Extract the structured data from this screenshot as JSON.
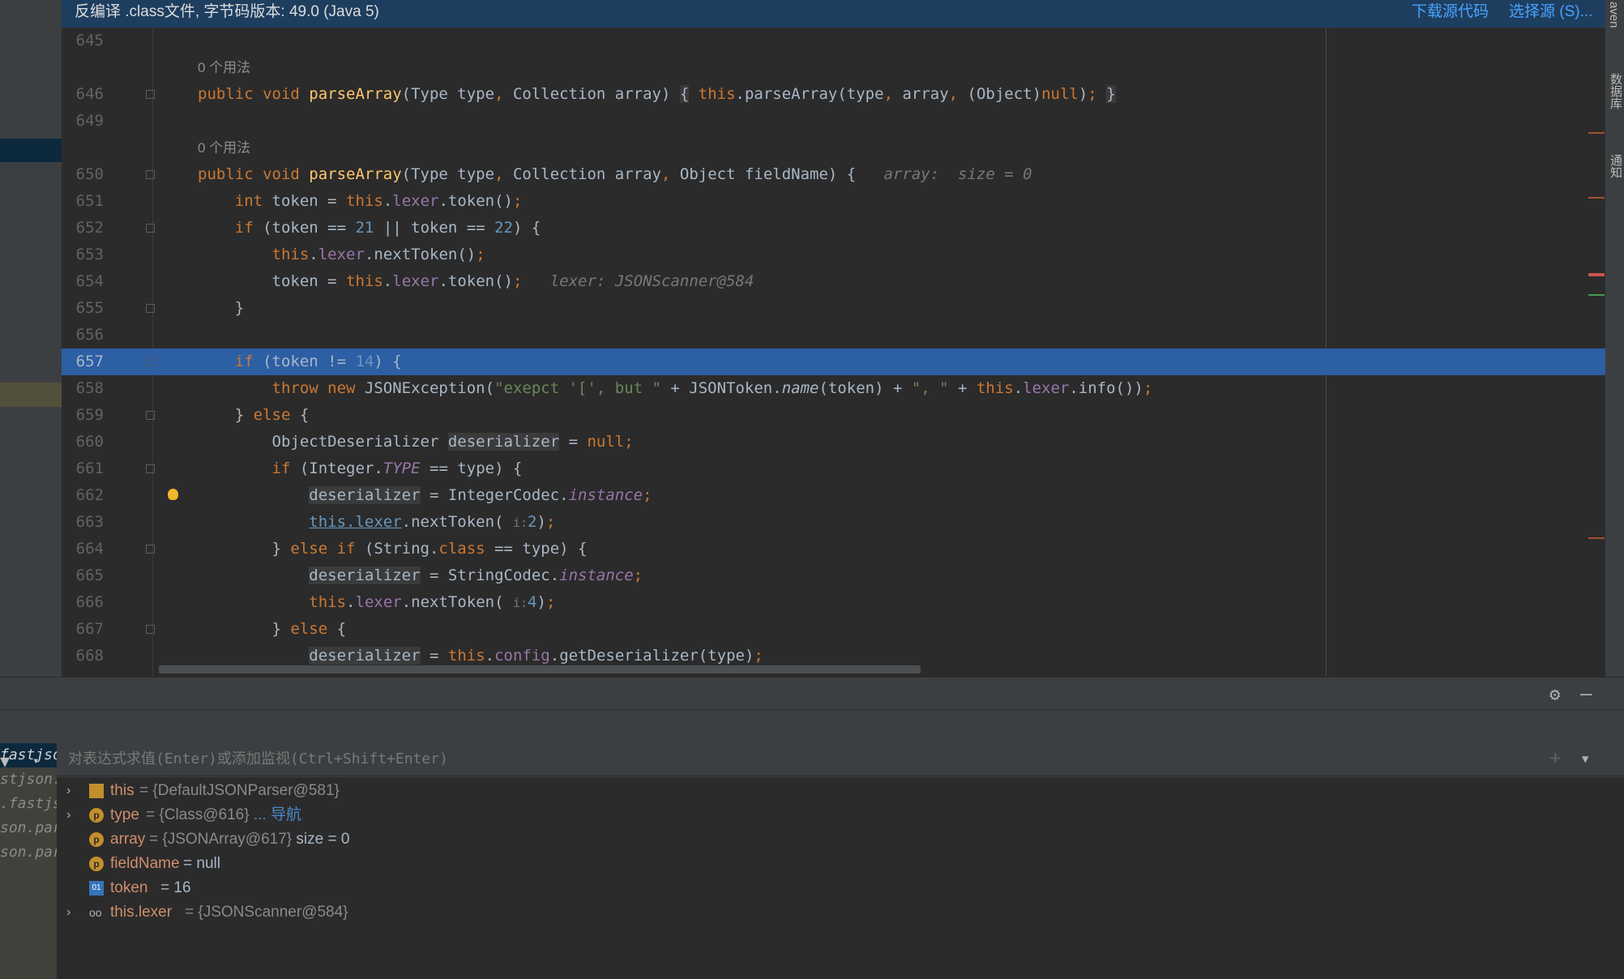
{
  "banner": {
    "title": "反编译 .class文件, 字节码版本: 49.0 (Java 5)",
    "download_source": "下载源代码",
    "choose_source": "选择源 (S)..."
  },
  "right_strip": {
    "maven": "aven",
    "database": "数据库",
    "notifications": "通知"
  },
  "editor": {
    "usage_hint": "0 个用法",
    "current_line": "657",
    "lines": [
      "645",
      "646",
      "649",
      "650",
      "651",
      "652",
      "653",
      "654",
      "655",
      "656",
      "657",
      "658",
      "659",
      "660",
      "661",
      "662",
      "663",
      "664",
      "665",
      "666",
      "667",
      "668"
    ],
    "inline_hints": {
      "array": "array:  size = 0",
      "lexer": "lexer: JSONScanner@584"
    },
    "param_hint_i": "i:"
  },
  "debug": {
    "eval_placeholder": "对表达式求值(Enter)或添加监视(Ctrl+Shift+Enter)",
    "frames": [
      "fastjson.p",
      "stjson.se",
      ".fastjson",
      "son.pars",
      "son.pars"
    ],
    "variables": [
      {
        "name": "this",
        "value": "= {DefaultJSONParser@581}",
        "extra": "",
        "icon": "stack-icon"
      },
      {
        "name": "type",
        "value": "= {Class@616}",
        "extra": "... 导航",
        "icon": "param-icon"
      },
      {
        "name": "array",
        "value": "= {JSONArray@617}",
        "extra": "size = 0",
        "icon": "param-icon"
      },
      {
        "name": "fieldName",
        "value": "= null",
        "extra": "",
        "icon": "param-icon"
      },
      {
        "name": "token",
        "value": "= 16",
        "extra": "",
        "icon": "local-int-icon"
      },
      {
        "name": "this.lexer",
        "value": "= {JSONScanner@584}",
        "extra": "",
        "icon": "watch-glasses-icon"
      }
    ]
  },
  "colors": {
    "editor_bg": "#2b2b2b",
    "current_line": "#2d5fa5",
    "banner_bg": "#1e3e5f",
    "keyword": "#cc7832",
    "method": "#ffc66d",
    "number": "#6897bb",
    "string": "#6a8759",
    "field": "#9876aa"
  }
}
